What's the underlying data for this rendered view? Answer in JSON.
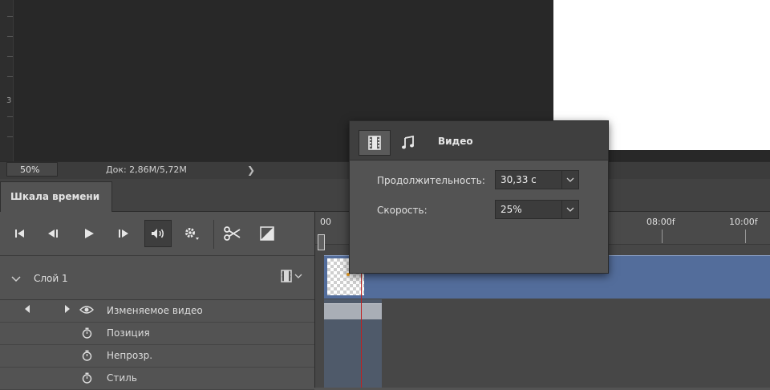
{
  "canvas": {
    "ruler_number": "3"
  },
  "status": {
    "zoom": "50%",
    "doc_info": "Док: 2,86M/5,72M",
    "arrow": "❯"
  },
  "panel": {
    "tab_label": "Шкала времени"
  },
  "controls": {
    "go_first": "go-to-first-frame-icon",
    "prev_frame": "previous-frame-icon",
    "play": "play-icon",
    "next_frame": "next-frame-icon",
    "audio": "speaker-icon",
    "settings": "gear-icon",
    "split": "scissors-icon",
    "transition": "transition-icon"
  },
  "layer": {
    "name": "Слой 1",
    "chevron": "chevron-down-icon",
    "film_icon": "film-icon"
  },
  "properties": [
    {
      "label": "Изменяемое видео"
    },
    {
      "label": "Позиция"
    },
    {
      "label": "Непрозр."
    },
    {
      "label": "Стиль"
    }
  ],
  "timeline": {
    "start_label": "00",
    "marks": [
      "08:00f",
      "10:00f"
    ]
  },
  "popup": {
    "title": "Видео",
    "duration_label": "Продолжительность:",
    "duration_value": "30,33 с",
    "speed_label": "Скорость:",
    "speed_value": "25%"
  },
  "colors": {
    "accent": "#536d9b",
    "playhead": "#c02020",
    "panel": "#535353",
    "canvas": "#282828"
  }
}
